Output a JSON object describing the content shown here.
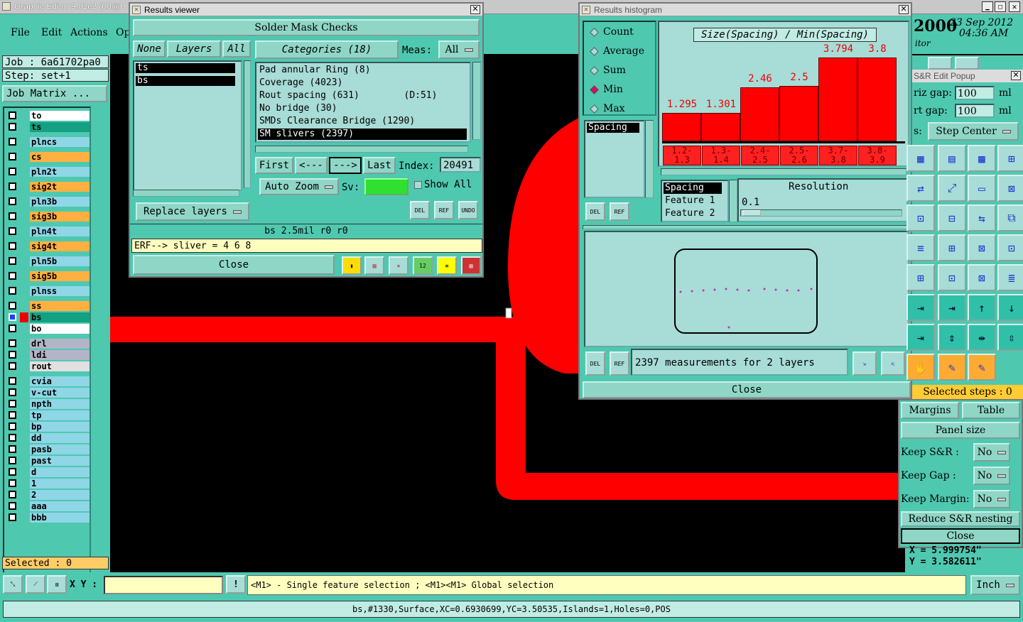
{
  "app": {
    "title": "Graphic Editor 9.02c2 (00@H",
    "menu": [
      "File",
      "Edit",
      "Actions",
      "Op"
    ],
    "date": "23 Sep 2012",
    "time": "04:36 AM",
    "year_partial": "2000",
    "editor_partial": "itor"
  },
  "left": {
    "job": "Job : 6a61702pa0",
    "step": "Step: set+1",
    "job_matrix": "Job Matrix ...",
    "selected": "Selected : 0",
    "layers": [
      {
        "name": "to",
        "color": "#ffffff"
      },
      {
        "name": "ts",
        "color": "#14a082"
      },
      {
        "name": "plncs",
        "color": "#8fd6e6"
      },
      {
        "name": "cs",
        "color": "#ffb040"
      },
      {
        "name": "pln2t",
        "color": "#8fd6e6"
      },
      {
        "name": "sig2t",
        "color": "#ffb040"
      },
      {
        "name": "pln3b",
        "color": "#8fd6e6"
      },
      {
        "name": "sig3b",
        "color": "#ffb040"
      },
      {
        "name": "pln4t",
        "color": "#8fd6e6"
      },
      {
        "name": "sig4t",
        "color": "#ffb040"
      },
      {
        "name": "pln5b",
        "color": "#8fd6e6"
      },
      {
        "name": "sig5b",
        "color": "#ffb040"
      },
      {
        "name": "plnss",
        "color": "#8fd6e6"
      },
      {
        "name": "ss",
        "color": "#ffb040"
      },
      {
        "name": "bs",
        "color": "#14a082"
      },
      {
        "name": "bo",
        "color": "#ffffff"
      },
      {
        "name": "drl",
        "color": "#b4b4c8"
      },
      {
        "name": "ldi",
        "color": "#b4b4c8"
      },
      {
        "name": "rout",
        "color": "#e0e0e0"
      },
      {
        "name": "cvia",
        "color": "#8fd6e6"
      },
      {
        "name": "v-cut",
        "color": "#8fd6e6"
      },
      {
        "name": "npth",
        "color": "#8fd6e6"
      },
      {
        "name": "tp",
        "color": "#8fd6e6"
      },
      {
        "name": "bp",
        "color": "#8fd6e6"
      },
      {
        "name": "dd",
        "color": "#8fd6e6"
      },
      {
        "name": "pasb",
        "color": "#8fd6e6"
      },
      {
        "name": "past",
        "color": "#8fd6e6"
      },
      {
        "name": "d",
        "color": "#8fd6e6"
      },
      {
        "name": "1",
        "color": "#8fd6e6"
      },
      {
        "name": "2",
        "color": "#8fd6e6"
      },
      {
        "name": "aaa",
        "color": "#8fd6e6"
      },
      {
        "name": "bbb",
        "color": "#8fd6e6"
      }
    ]
  },
  "results_viewer": {
    "title": "Results viewer",
    "header": "Solder Mask Checks",
    "none": "None",
    "layers_btn": "Layers",
    "all": "All",
    "layer_list": [
      "ts",
      "bs"
    ],
    "categories": "Categories (18)",
    "meas_label": "Meas:",
    "meas_value": "All",
    "cat_items": [
      "Pad annular Ring (8)",
      "Coverage (4023)",
      "Rout spacing (631)        (D:51)",
      "No bridge (30)",
      "SMDs Clearance Bridge (1290)",
      "SM slivers (2397)"
    ],
    "first": "First",
    "prev": "<---",
    "next": "--->",
    "last": "Last",
    "index_label": "Index:",
    "index_value": "20491",
    "auto_zoom": "Auto Zoom",
    "sv": "Sv:",
    "show_all": "Show All",
    "replace_layers": "Replace layers",
    "del": "DEL",
    "ref": "REF",
    "undo": "UNDO",
    "info": "bs 2.5mil  r0  r0",
    "erf": "ERF--> sliver = 4 6 8",
    "close": "Close"
  },
  "histogram": {
    "title": "Results histogram",
    "radios": [
      {
        "label": "Count",
        "on": false
      },
      {
        "label": "Average",
        "on": false
      },
      {
        "label": "Sum",
        "on": false
      },
      {
        "label": "Min",
        "on": true
      },
      {
        "label": "Max",
        "on": false
      }
    ],
    "spacing_item": "Spacing",
    "chart_title": "Size(Spacing) / Min(Spacing)",
    "values": [
      "1.295",
      "1.301",
      "2.46",
      "2.5",
      "3.794",
      "3.8"
    ],
    "ranges": [
      [
        "1.2-",
        "1.3"
      ],
      [
        "1.3-",
        "1.4"
      ],
      [
        "2.4-",
        "2.5"
      ],
      [
        "2.5-",
        "2.6"
      ],
      [
        "3.7-",
        "3.8"
      ],
      [
        "3.8-",
        "3.9"
      ]
    ],
    "list": [
      "Spacing",
      "Feature 1",
      "Feature 2"
    ],
    "resolution_label": "Resolution",
    "resolution_value": "0.1",
    "summary": "2397 measurements for 2 layers",
    "close": "Close"
  },
  "sr_popup": {
    "title": "S&R Edit Popup",
    "horiz_gap_label": "riz gap:",
    "horiz_gap": "100",
    "vert_gap_label": "rt  gap:",
    "vert_gap": "100",
    "unit": "ml",
    "step_label": "s:",
    "step_center": "Step Center",
    "selected_steps": "Selected steps : 0",
    "margins": "Margins",
    "table": "Table",
    "panel_size": "Panel size",
    "keep_sr": "Keep S&R  :",
    "keep_gap": "Keep Gap   :",
    "keep_margin": "Keep Margin:",
    "no": "No",
    "reduce": "Reduce S&R nesting",
    "close": "Close"
  },
  "coords": {
    "x": "X = 5.999754\"",
    "y": "Y = 3.582611\""
  },
  "bottom": {
    "xy_label": "X Y :",
    "hint": "<M1> - Single feature selection ; <M1><M1> Global selection",
    "unit": "Inch",
    "status": "bs,#1330,Surface,XC=0.6930699,YC=3.50535,Islands=1,Holes=0,POS"
  },
  "colors": {
    "canvas": "#000000",
    "feature": "#ff0000",
    "panel": "#4fc8b0",
    "panel_light": "#a8dcd6"
  }
}
